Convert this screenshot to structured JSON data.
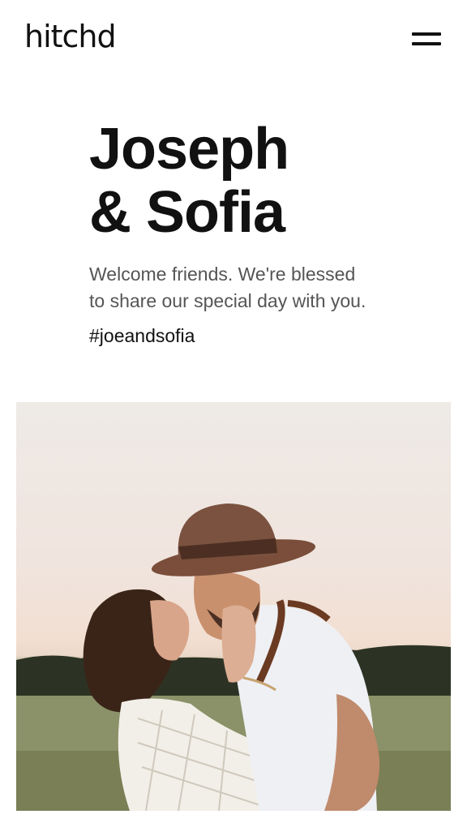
{
  "header": {
    "logo": "hitchd",
    "menu_icon": "hamburger-icon"
  },
  "hero": {
    "title_line1": "Joseph",
    "title_line2": "& Sofia",
    "subtitle_line1": "Welcome friends. We're blessed",
    "subtitle_line2": "to share our special day with you.",
    "hashtag": "#joeandsofia"
  },
  "photo": {
    "subject": "couple-photo"
  },
  "colors": {
    "text": "#111111",
    "subtitle": "#555555",
    "background": "#ffffff"
  }
}
